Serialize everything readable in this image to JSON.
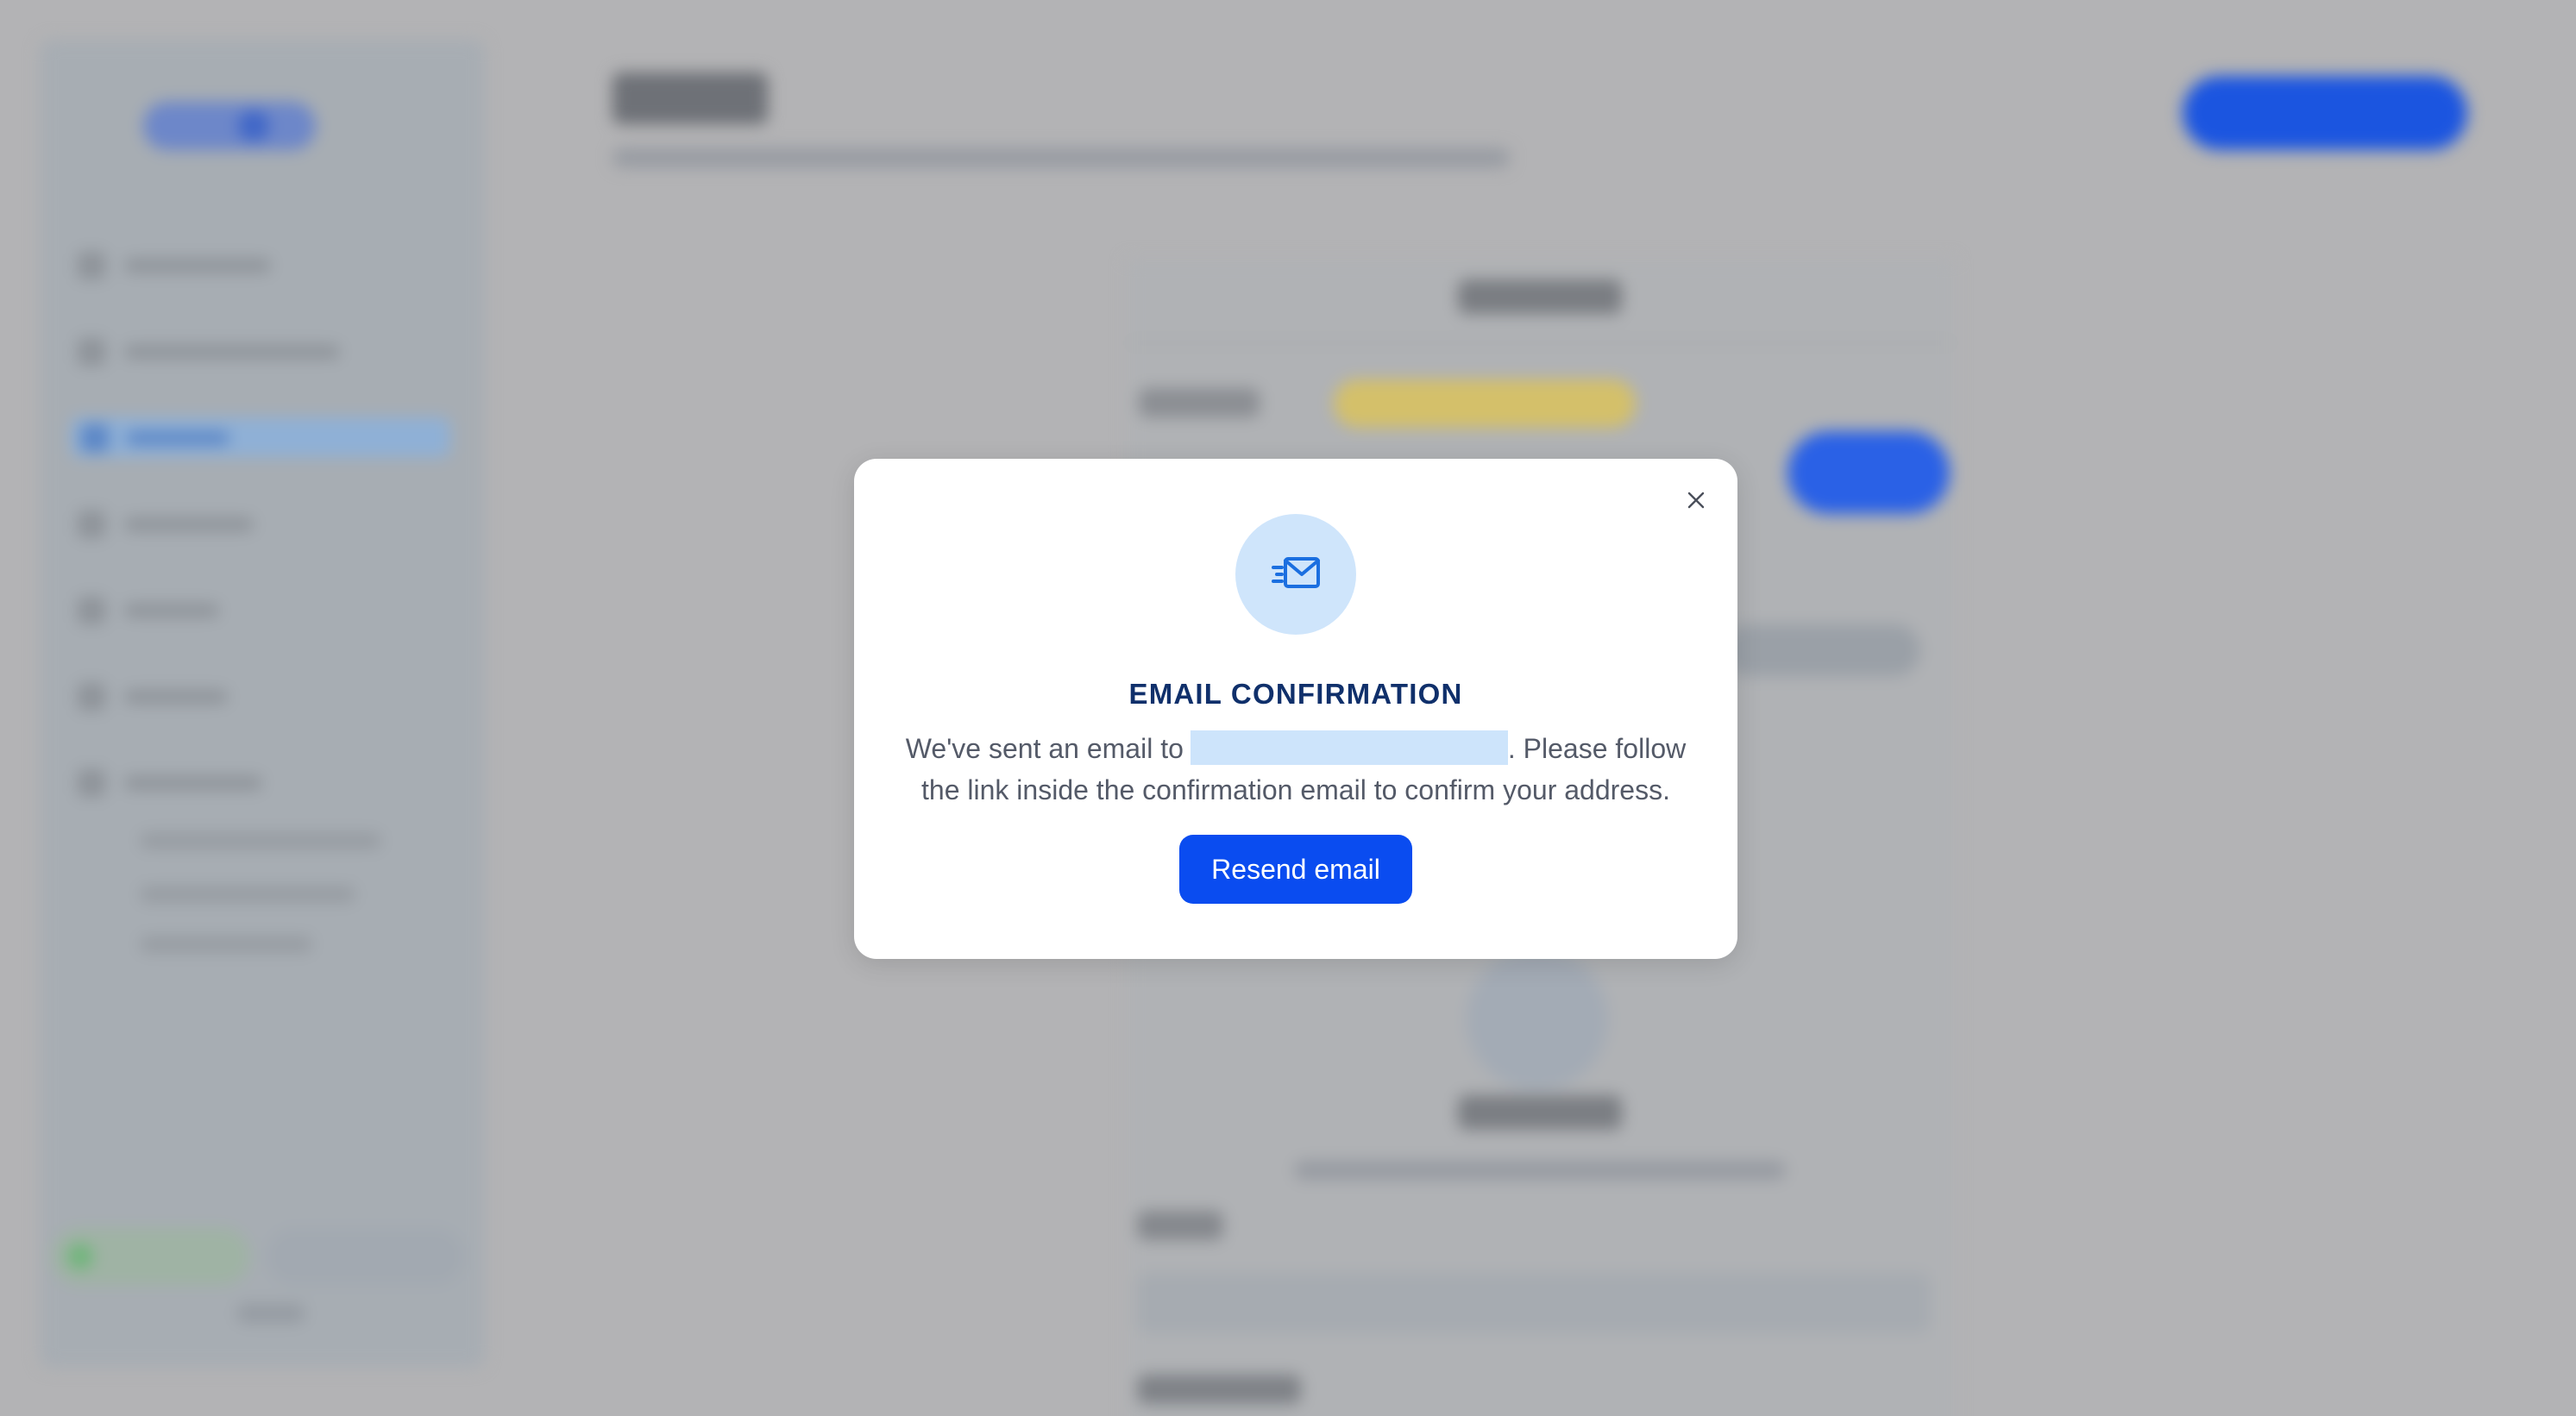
{
  "modal": {
    "title": "EMAIL CONFIRMATION",
    "text_before_email": "We've sent an email to",
    "text_after_email": ". Please follow the link inside the confirmation email to confirm your address.",
    "resend_label": "Resend email",
    "icons": {
      "close": "close-icon",
      "hero": "mail-sent-icon"
    }
  },
  "colors": {
    "title": "#10306b",
    "body_text": "#545a68",
    "primary_button": "#0a4cf0",
    "icon_circle": "#cfe5fb",
    "icon_stroke": "#1b6fe0",
    "email_highlight": "#cde4fb",
    "overlay": "#b3b3b5"
  }
}
